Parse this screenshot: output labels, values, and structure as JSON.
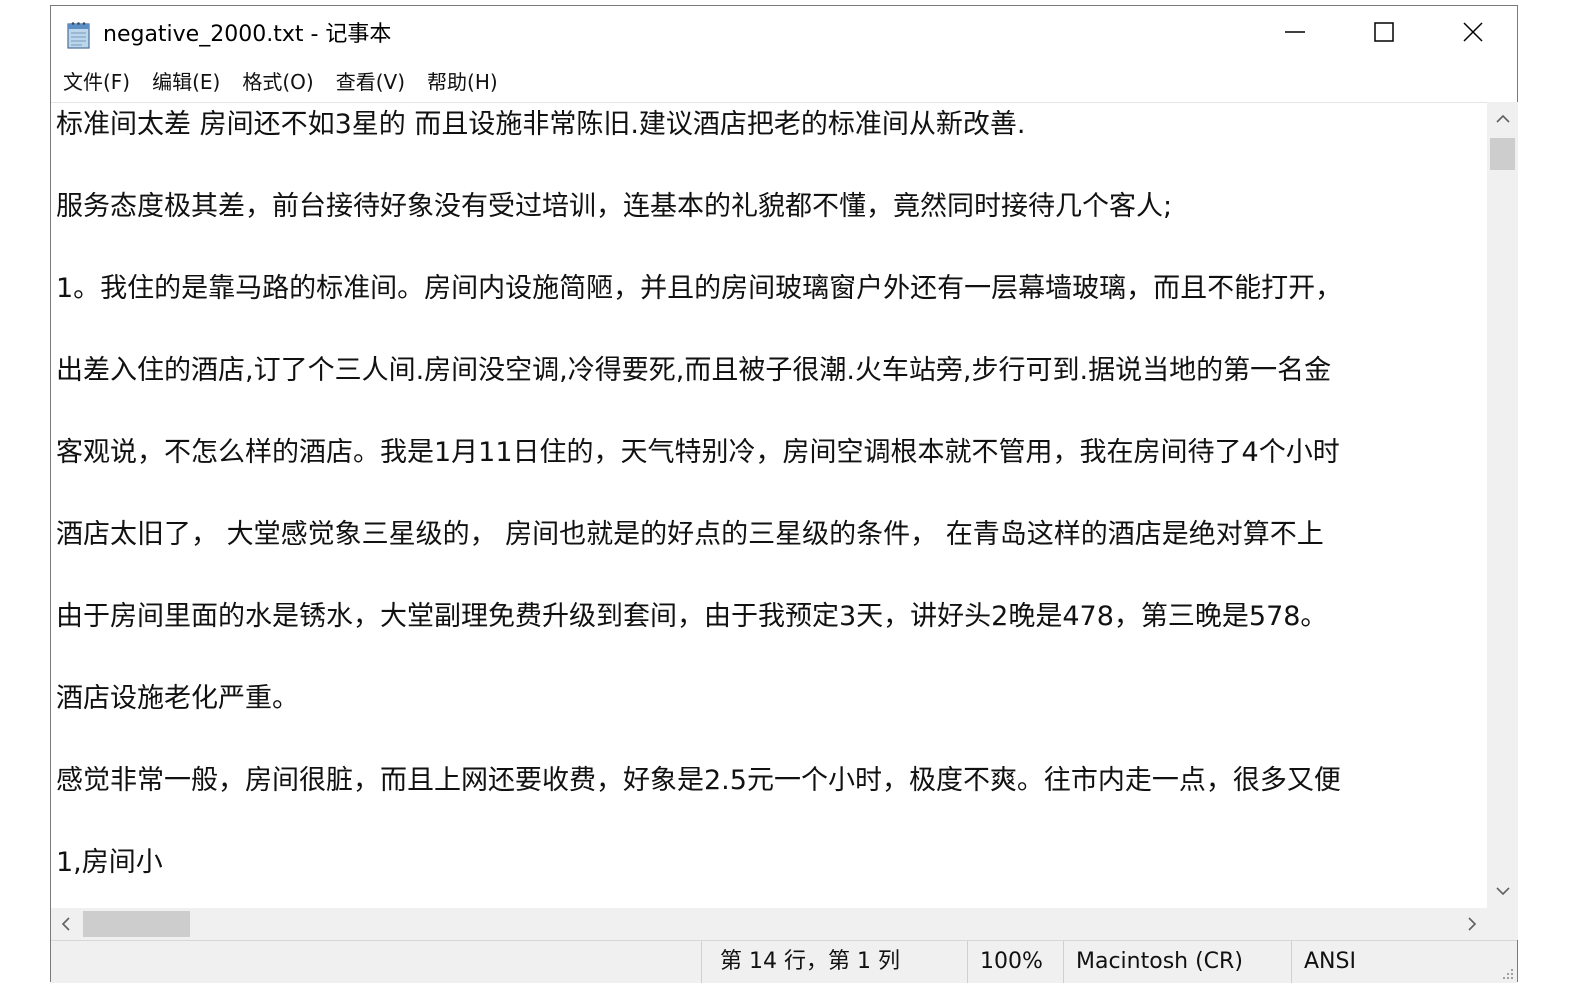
{
  "window": {
    "title": "negative_2000.txt - 记事本",
    "icon": "notepad-icon"
  },
  "controls": {
    "minimize_icon": "minimize-icon",
    "maximize_icon": "maximize-icon",
    "close_icon": "close-icon"
  },
  "menu": {
    "items": [
      {
        "label": "文件(F)"
      },
      {
        "label": "编辑(E)"
      },
      {
        "label": "格式(O)"
      },
      {
        "label": "查看(V)"
      },
      {
        "label": "帮助(H)"
      }
    ]
  },
  "editor": {
    "lines": [
      "标准间太差 房间还不如3星的 而且设施非常陈旧.建议酒店把老的标准间从新改善.",
      "",
      "服务态度极其差，前台接待好象没有受过培训，连基本的礼貌都不懂，竟然同时接待几个客人;",
      "",
      "1。我住的是靠马路的标准间。房间内设施简陋，并且的房间玻璃窗户外还有一层幕墙玻璃，而且不能打开，",
      "",
      "出差入住的酒店,订了个三人间.房间没空调,冷得要死,而且被子很潮.火车站旁,步行可到.据说当地的第一名金",
      "",
      "客观说，不怎么样的酒店。我是1月11日住的，天气特别冷，房间空调根本就不管用，我在房间待了4个小时",
      "",
      "酒店太旧了， 大堂感觉象三星级的， 房间也就是的好点的三星级的条件， 在青岛这样的酒店是绝对算不上",
      "",
      "由于房间里面的水是锈水，大堂副理免费升级到套间，由于我预定3天，讲好头2晚是478，第三晚是578。",
      "",
      "酒店设施老化严重。",
      "",
      "感觉非常一般，房间很脏，而且上网还要收费，好象是2.5元一个小时，极度不爽。往市内走一点，很多又便",
      "",
      "1,房间小"
    ]
  },
  "scrollbars": {
    "up_icon": "scroll-up-arrow-icon",
    "down_icon": "scroll-down-arrow-icon",
    "left_icon": "scroll-left-arrow-icon",
    "right_icon": "scroll-right-arrow-icon"
  },
  "status": {
    "position": "第 14 行，第 1 列",
    "zoom": "100%",
    "line_ending": "Macintosh (CR)",
    "encoding": "ANSI"
  }
}
